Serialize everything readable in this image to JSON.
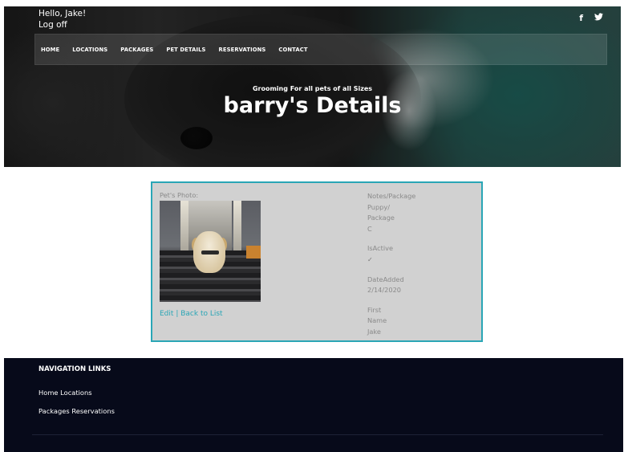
{
  "header": {
    "greeting": "Hello, Jake!",
    "logoff": "Log off",
    "social": {
      "facebook": "f",
      "twitter": "🐦"
    },
    "nav": [
      "HOME",
      "LOCATIONS",
      "PACKAGES",
      "PET DETAILS",
      "RESERVATIONS",
      "CONTACT"
    ],
    "subtitle": "Grooming For all pets of all Sizes",
    "title": "barry's Details"
  },
  "details": {
    "photo_label": "Pet's Photo:",
    "edit_link": "Edit",
    "separator": "|",
    "back_link": "Back to List",
    "notes_label_1": "Notes/Package",
    "notes_value_1": "Puppy/",
    "notes_value_2": "Package",
    "notes_value_3": "C",
    "isactive_label": "IsActive",
    "isactive_checked": true,
    "isactive_mark": "✓",
    "dateadded_label": "DateAdded",
    "dateadded_value": "2/14/2020",
    "firstname_label_1": "First",
    "firstname_label_2": "Name",
    "firstname_value": "Jake"
  },
  "footer": {
    "heading": "NAVIGATION LINKS",
    "row1": "Home Locations",
    "row2": "Packages Reservations"
  },
  "colors": {
    "accent": "#2aa6b6",
    "card_bg": "#d1d1d1",
    "footer_bg": "#070a1a"
  }
}
